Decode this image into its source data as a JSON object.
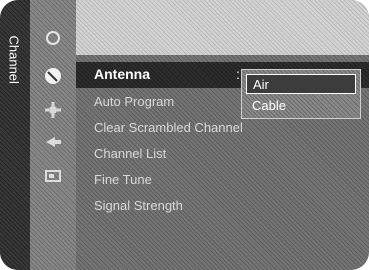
{
  "category": {
    "label": "Channel"
  },
  "icons": [
    "picture-icon",
    "channel-icon",
    "setup-icon",
    "input-icon",
    "application-icon"
  ],
  "menu": {
    "items": [
      {
        "label": "Antenna",
        "active": true
      },
      {
        "label": "Auto Program"
      },
      {
        "label": "Clear Scrambled Channel"
      },
      {
        "label": "Channel List"
      },
      {
        "label": "Fine Tune"
      },
      {
        "label": "Signal Strength"
      }
    ],
    "colon": ":"
  },
  "dropdown": {
    "options": [
      "Air",
      "Cable"
    ],
    "selected": "Air"
  }
}
